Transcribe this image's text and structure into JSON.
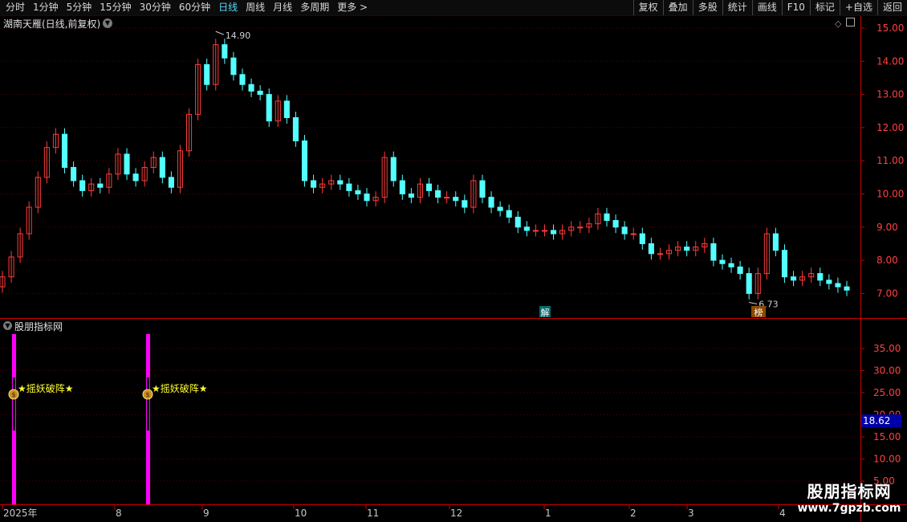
{
  "toolbar": {
    "periods": [
      "分时",
      "1分钟",
      "5分钟",
      "15分钟",
      "30分钟",
      "60分钟",
      "日线",
      "周线",
      "月线",
      "多周期",
      "更多 >"
    ],
    "active_period": "日线",
    "actions": [
      "复权",
      "叠加",
      "多股",
      "统计",
      "画线",
      "F10",
      "标记",
      "+自选",
      "返回"
    ]
  },
  "price_panel": {
    "title": "湖南天雁(日线,前复权)",
    "y_ticks": [
      "15.00",
      "14.00",
      "13.00",
      "12.00",
      "11.00",
      "10.00",
      "9.00",
      "8.00",
      "7.00"
    ],
    "high_label": "14.90",
    "low_label": "6.73",
    "marker_jie": "解",
    "marker_bang": "榜"
  },
  "indicator_panel": {
    "title": "股朋指标网",
    "y_ticks": [
      "35.00",
      "30.00",
      "25.00",
      "20.00",
      "15.00",
      "10.00",
      "5.00"
    ],
    "current_value": "18.62",
    "signal_label": "★摇妖破阵★",
    "signal_icon": "money-bag-icon"
  },
  "x_axis": {
    "labels": [
      "2025年",
      "8",
      "9",
      "10",
      "11",
      "12",
      "1",
      "2",
      "3",
      "4"
    ]
  },
  "watermark": {
    "main": "股朋指标网",
    "url": "www.7gpzb.com"
  },
  "colors": {
    "up": "#ff3c3c",
    "down": "#54ffff",
    "grid": "#5a0000",
    "axis": "#cc0000",
    "indicator_bar": "#ff00ff",
    "signal_text": "#ffff33",
    "value_box": "#0000a8"
  },
  "chart_data": {
    "type": "candlestick",
    "y_range": [
      6.6,
      15.1
    ],
    "low": 6.73,
    "high": 14.9,
    "close": [
      7.5,
      8.1,
      8.8,
      9.6,
      10.5,
      11.4,
      11.8,
      10.8,
      10.4,
      10.1,
      10.3,
      10.2,
      10.6,
      11.2,
      10.6,
      10.4,
      10.8,
      11.1,
      10.5,
      10.2,
      11.3,
      12.4,
      13.9,
      13.3,
      14.5,
      14.1,
      13.6,
      13.3,
      13.1,
      13.0,
      12.2,
      12.8,
      12.3,
      11.6,
      10.4,
      10.2,
      10.3,
      10.4,
      10.3,
      10.1,
      10.0,
      9.8,
      9.9,
      11.1,
      10.4,
      10.0,
      9.9,
      10.3,
      10.1,
      9.9,
      9.9,
      9.8,
      9.6,
      10.4,
      9.9,
      9.6,
      9.5,
      9.3,
      9.0,
      8.9,
      8.9,
      8.9,
      8.8,
      8.9,
      9.0,
      9.0,
      9.1,
      9.4,
      9.2,
      9.0,
      8.8,
      8.8,
      8.5,
      8.2,
      8.2,
      8.3,
      8.4,
      8.3,
      8.4,
      8.5,
      8.0,
      7.9,
      7.8,
      7.6,
      7.0,
      7.6,
      8.8,
      8.3,
      7.5,
      7.4,
      7.5,
      7.6,
      7.4,
      7.3,
      7.2,
      7.1
    ]
  }
}
